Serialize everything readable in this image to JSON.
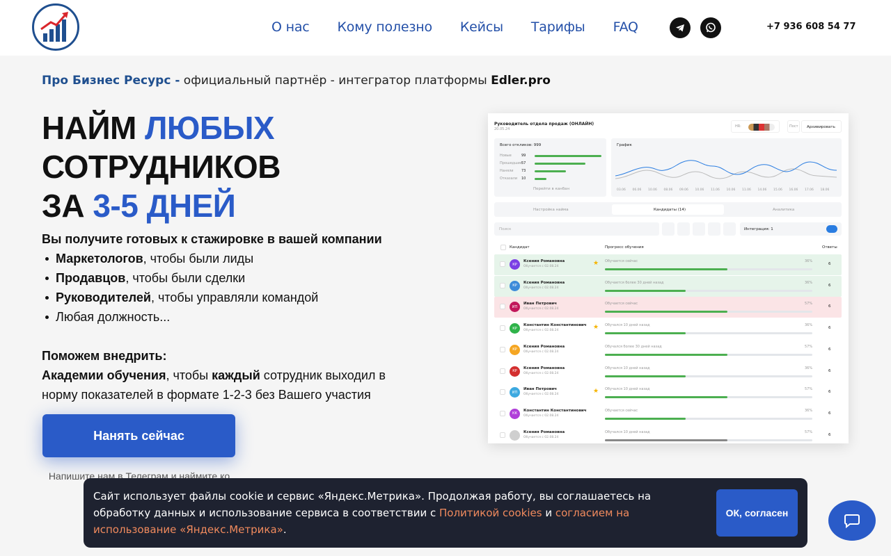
{
  "nav": [
    {
      "label": "О нас"
    },
    {
      "label": "Кому полезно"
    },
    {
      "label": "Кейсы"
    },
    {
      "label": "Тарифы"
    },
    {
      "label": "FAQ"
    }
  ],
  "social": {
    "telegram_icon": "telegram-icon",
    "whatsapp_icon": "whatsapp-icon"
  },
  "phone": "+7 936 608 54 77",
  "partner": {
    "brand": "Про Бизнес Ресурс -",
    "text": " официальный партнёр - интегратор платформы ",
    "platform": "Edler.pro"
  },
  "hero": {
    "line1_a": "НАЙМ ",
    "line1_b": "ЛЮБЫХ",
    "line2": "СОТРУДНИКОВ",
    "line3_a": "ЗА ",
    "line3_b": "3-5 ДНЕЙ"
  },
  "desc": {
    "lead": "Вы получите готовых к стажировке в вашей компании",
    "items": [
      {
        "bold": "Маркетологов",
        "rest": ", чтобы были лиды"
      },
      {
        "bold": "Продавцов",
        "rest": ", чтобы были сделки"
      },
      {
        "bold": "Руководителей",
        "rest": ", чтобы управляли командой"
      },
      {
        "bold": "",
        "rest": "Любая должность..."
      }
    ]
  },
  "help": {
    "title": "Поможем внедрить:",
    "bold1": "Академии обучения",
    "text1": ", чтобы ",
    "bold2": "каждый",
    "text2": " сотрудник выходил в норму показателей в формате 1-2-3 без Вашего участия"
  },
  "cta_label": "Нанять сейчас",
  "telegram_note": "Напишите нам в Телеграм и наймите ко",
  "dashboard": {
    "title": "Руководитель отдела продаж (ОНЛАЙН)",
    "date": "20.05.24",
    "hr_label": "HR:",
    "archive_button": "Архивировать",
    "post_label": "Пост",
    "total_responses": "Всего откликов: 999",
    "funnel": [
      {
        "label": "Новые",
        "value": "99",
        "fraction": 1.0
      },
      {
        "label": "Прошедшие",
        "value": "57",
        "fraction": 0.76
      },
      {
        "label": "Наняли",
        "value": "73",
        "fraction": 0.47
      },
      {
        "label": "Отказали",
        "value": "10",
        "fraction": 0.18
      }
    ],
    "kanban_link": "Перейти в канбан",
    "chart_title": "График",
    "chart_dates": [
      "03.06",
      "06.06",
      "10.06",
      "08.06",
      "09.06",
      "10.06",
      "11.06",
      "10.06",
      "11.06",
      "14.06",
      "15.06",
      "16.06",
      "17.06",
      "18.06"
    ],
    "tabs": [
      "Настройка найма",
      "Кандидаты (14)",
      "Аналитика"
    ],
    "search_placeholder": "Поиск",
    "integration_label": "Интеграция: 1",
    "columns": [
      "Кандидат",
      "Прогресс обучения",
      "Ответы"
    ],
    "rows": [
      {
        "initials": "КР",
        "name": "Ксения Романовна",
        "sub": "Обучается с 02.08.24",
        "status": "Обучается сейчас",
        "pct": "36%",
        "progress": 0.59,
        "answers": "6",
        "avatar_color": "#7b3fe4",
        "bg": "#e6f4ea",
        "star": true
      },
      {
        "initials": "КР",
        "name": "Ксения Романовна",
        "sub": "Обучается с 02.08.24",
        "status": "Обучается более 30 дней назад",
        "pct": "36%",
        "progress": 0.39,
        "answers": "6",
        "avatar_color": "#3d8bd9",
        "bg": "#e6f4ea",
        "star": false
      },
      {
        "initials": "ИП",
        "name": "Иван Петрович",
        "sub": "Обучается с 02.08.24",
        "status": "Обучается сейчас",
        "pct": "57%",
        "progress": 0.59,
        "answers": "6",
        "avatar_color": "#c2185b",
        "bg": "#fbe4e6",
        "star": false
      },
      {
        "initials": "КР",
        "name": "Константин Константинович",
        "sub": "Обучается с 02.08.24",
        "status": "Обучался 10 дней назад",
        "pct": "36%",
        "progress": 0.39,
        "answers": "6",
        "avatar_color": "#2fb34a",
        "bg": "#ffffff",
        "star": true
      },
      {
        "initials": "КР",
        "name": "Ксения Романовна",
        "sub": "Обучается с 02.08.24",
        "status": "Обучался более 30 дней назад",
        "pct": "57%",
        "progress": 0.59,
        "answers": "6",
        "avatar_color": "#f5a623",
        "bg": "#ffffff",
        "star": false
      },
      {
        "initials": "КР",
        "name": "Ксения Романовна",
        "sub": "Обучается с 02.08.24",
        "status": "Обучался 10 дней назад",
        "pct": "36%",
        "progress": 0.39,
        "answers": "6",
        "avatar_color": "#d32f2f",
        "bg": "#ffffff",
        "star": false
      },
      {
        "initials": "ИП",
        "name": "Иван Петрович",
        "sub": "Обучается с 02.08.24",
        "status": "Обучался 10 дней назад",
        "pct": "57%",
        "progress": 0.59,
        "answers": "6",
        "avatar_color": "#3da9e0",
        "bg": "#ffffff",
        "star": true
      },
      {
        "initials": "КК",
        "name": "Константин Константинович",
        "sub": "Обучается с 02.08.24",
        "status": "Обучается сейчас",
        "pct": "36%",
        "progress": 0.39,
        "answers": "6",
        "avatar_color": "#b03fd9",
        "bg": "#ffffff",
        "star": false
      },
      {
        "initials": "",
        "name": "Ксения Романовна",
        "sub": "Обучается с 02.08.24",
        "status": "Обучался 10 дней назад",
        "pct": "57%",
        "progress": 0.59,
        "answers": "6",
        "avatar_color": "#cfcfcf",
        "bg": "#ffffff",
        "star": false
      }
    ]
  },
  "cookie": {
    "text1": "Сайт использует файлы cookie и сервис «Яндекс.Метрика». Продолжая работу, вы соглашаетесь на обработку данных и использование сервиса в соответствии с ",
    "link1": "Политикой cookies",
    "text2": " и ",
    "link2": "согласием на использование «Яндекс.Метрика»",
    "text3": ".",
    "ok_label": "ОК, согласен"
  },
  "chat_icon": "chat-bubble-icon"
}
